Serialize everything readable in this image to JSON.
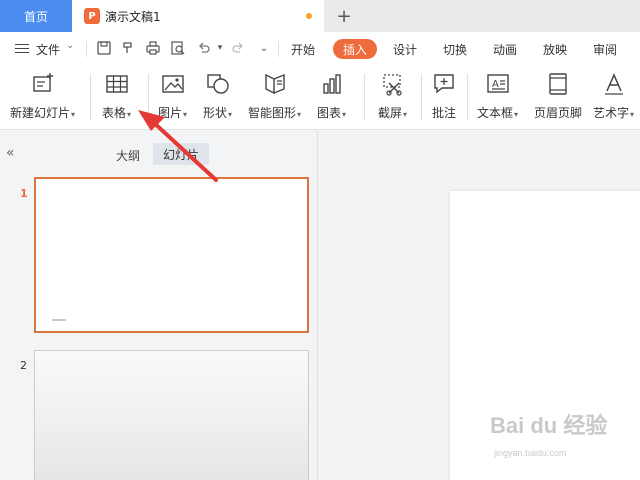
{
  "tabbar": {
    "home_label": "首页",
    "doc_logo": "P",
    "doc_title": "演示文稿1",
    "add_label": "+"
  },
  "menubar": {
    "file_label": "文件",
    "tabs": [
      "开始",
      "插入",
      "设计",
      "切换",
      "动画",
      "放映",
      "审阅"
    ],
    "active_tab": "插入"
  },
  "ribbon": {
    "items": [
      {
        "label": "新建幻灯片",
        "icon": "new-slide-icon"
      },
      {
        "label": "表格",
        "icon": "table-icon"
      },
      {
        "label": "图片",
        "icon": "picture-icon"
      },
      {
        "label": "形状",
        "icon": "shape-icon"
      },
      {
        "label": "智能图形",
        "icon": "smartart-icon"
      },
      {
        "label": "图表",
        "icon": "chart-icon"
      },
      {
        "label": "截屏",
        "icon": "screenshot-icon"
      },
      {
        "label": "批注",
        "icon": "comment-icon"
      },
      {
        "label": "文本框",
        "icon": "textbox-icon"
      },
      {
        "label": "页眉页脚",
        "icon": "header-footer-icon"
      },
      {
        "label": "艺术字",
        "icon": "wordart-icon"
      }
    ]
  },
  "panel": {
    "tab_outline": "大纲",
    "tab_slides": "幻灯片",
    "slide_numbers": [
      "1",
      "2"
    ]
  },
  "watermark": {
    "main": "Bai du 经验",
    "sub": "jingyan.baidu.com"
  },
  "colors": {
    "accent": "#ef6b3b",
    "home_tab": "#4b8ef0",
    "arrow": "#e53935"
  }
}
